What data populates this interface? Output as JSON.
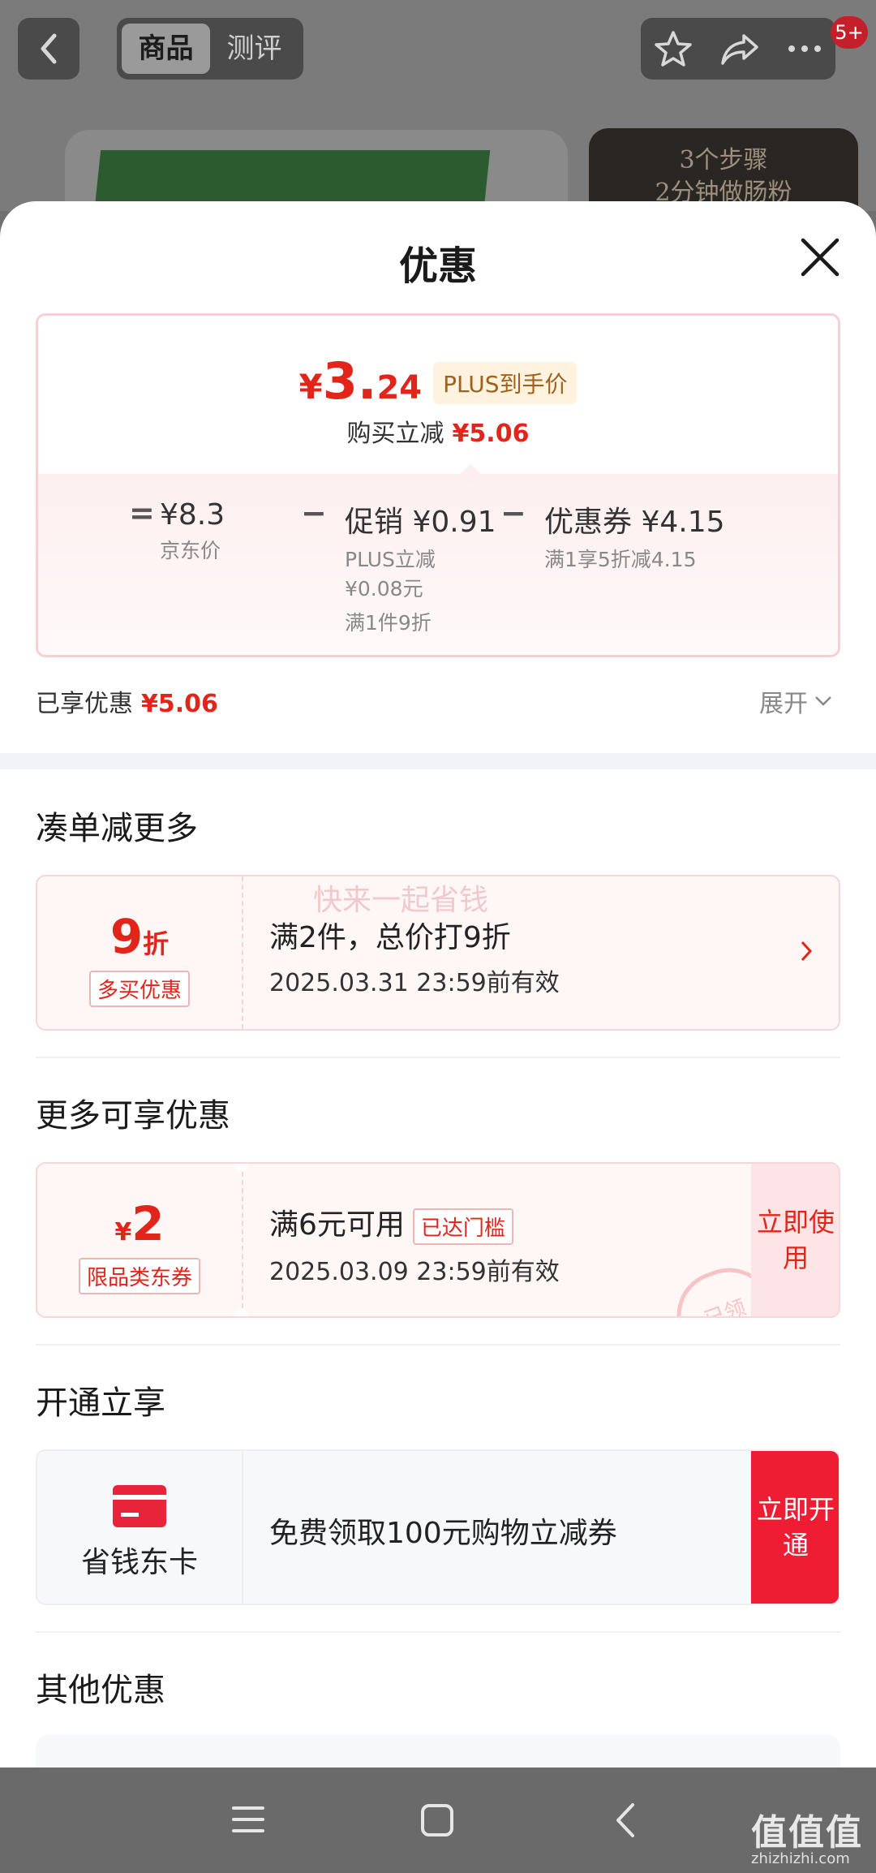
{
  "header": {
    "tabs": [
      {
        "label": "商品",
        "active": true
      },
      {
        "label": "测评",
        "active": false
      }
    ],
    "badge": "5+",
    "icons": [
      "back-icon",
      "star-icon",
      "share-icon",
      "more-icon"
    ]
  },
  "background": {
    "thumb_line1": "3个步骤",
    "thumb_line2": "2分钟做肠粉"
  },
  "sheet": {
    "title": "优惠",
    "price": {
      "currency": "¥",
      "int": "3.",
      "dec": "24",
      "plus_tag": "PLUS到手价",
      "sub_label": "购买立减",
      "sub_value": "¥5.06"
    },
    "breakdown": {
      "eq": "=",
      "minus": "−",
      "items": [
        {
          "big": "¥8.3",
          "lines": [
            "京东价"
          ]
        },
        {
          "big": "促销 ¥0.91",
          "lines": [
            "PLUS立减",
            "¥0.08元",
            "满1件9折"
          ]
        },
        {
          "big": "优惠券 ¥4.15",
          "lines": [
            "满1享5折减4.15"
          ]
        }
      ]
    },
    "enjoyed": {
      "label": "已享优惠",
      "value": "¥5.06"
    },
    "expand_label": "展开"
  },
  "sections": {
    "s1": {
      "title": "凑单减更多",
      "watermark": "快来一起省钱",
      "value_big": "9",
      "value_unit": "折",
      "tag": "多买优惠",
      "line1": "满2件，总价打9折",
      "line2": "2025.03.31 23:59前有效"
    },
    "s2": {
      "title": "更多可享优惠",
      "currency": "¥",
      "value_big": "2",
      "tag": "限品类东券",
      "line1": "满6元可用",
      "reached": "已达门槛",
      "line2": "2025.03.09 23:59前有效",
      "button": "立即使用",
      "stamp": "已领"
    },
    "s3": {
      "title": "开通立享",
      "card_label": "省钱东卡",
      "line1": "免费领取100元购物立减券",
      "button": "立即开通"
    },
    "s4": {
      "title": "其他优惠"
    }
  },
  "navbar": {
    "brand": "值值值",
    "brand_sub": "zhizhizhi.com"
  }
}
